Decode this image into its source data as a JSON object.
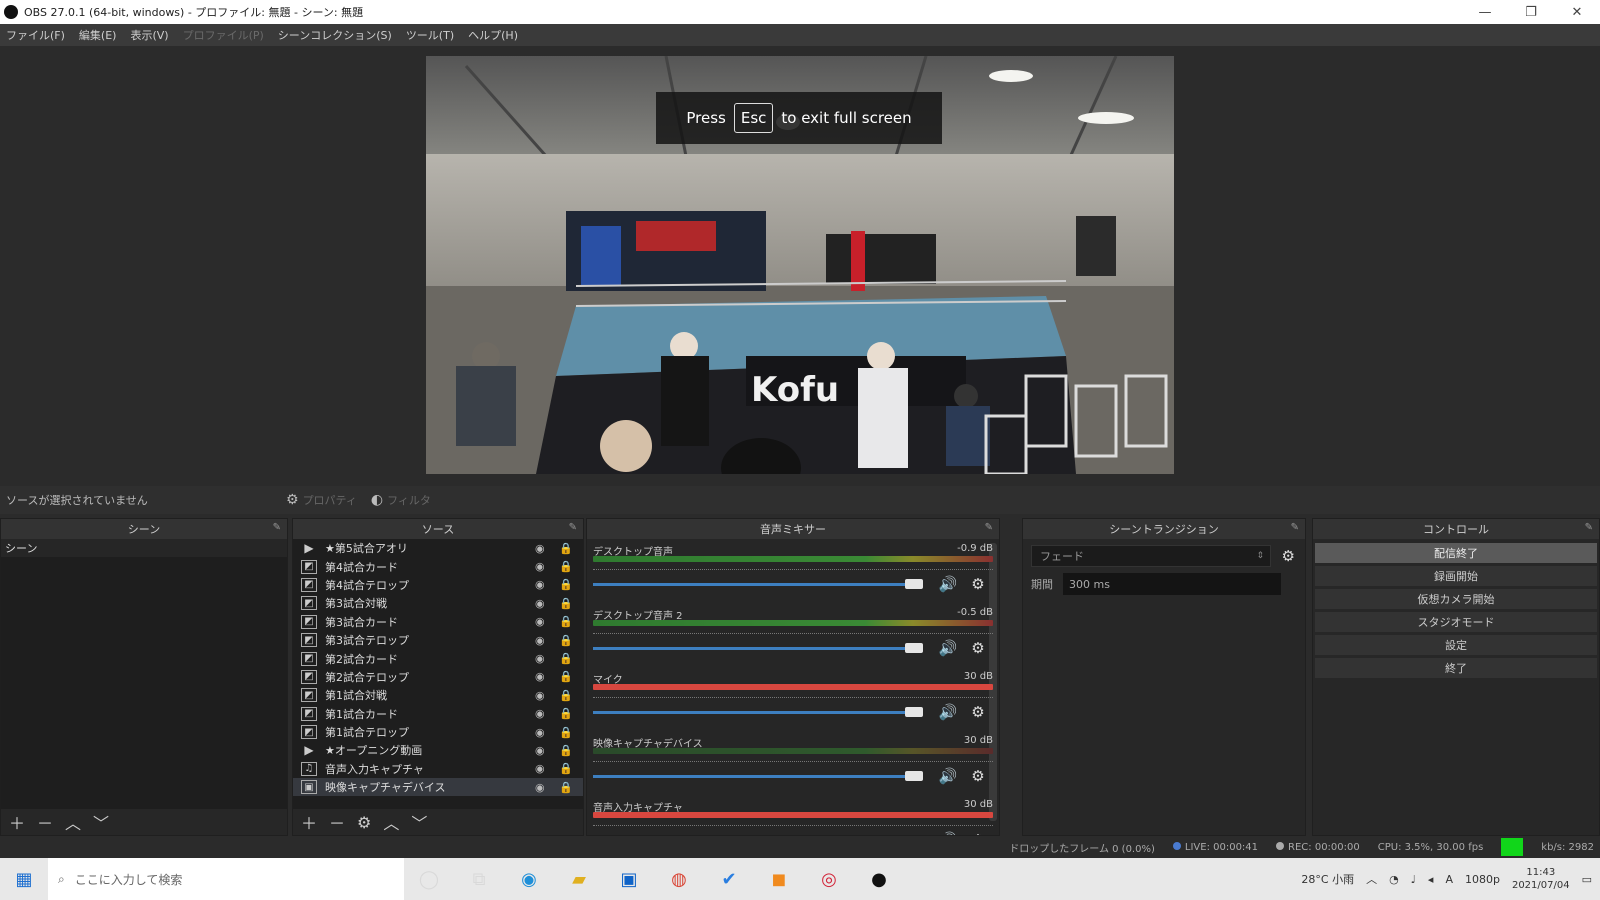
{
  "window": {
    "title": "OBS 27.0.1 (64-bit, windows) - プロファイル: 無題 - シーン: 無題",
    "minimize": "—",
    "restore": "❐",
    "close": "✕"
  },
  "menu": [
    "ファイル(F)",
    "編集(E)",
    "表示(V)",
    "プロファイル(P)",
    "シーンコレクション(S)",
    "ツール(T)",
    "ヘルプ(H)"
  ],
  "fullscreen_notice": {
    "press": "Press",
    "key": "Esc",
    "rest": "to exit full screen"
  },
  "source_bar": {
    "no_source": "ソースが選択されていません",
    "properties": "プロパティ",
    "filters": "フィルタ"
  },
  "scenes": {
    "title": "シーン",
    "items": [
      "シーン"
    ]
  },
  "sources": {
    "title": "ソース",
    "items": [
      {
        "name": "★第5試合アオリ",
        "icon": "play-icon"
      },
      {
        "name": "第4試合カード",
        "icon": "image-icon"
      },
      {
        "name": "第4試合テロップ",
        "icon": "image-icon"
      },
      {
        "name": "第3試合対戦",
        "icon": "image-icon"
      },
      {
        "name": "第3試合カード",
        "icon": "image-icon"
      },
      {
        "name": "第3試合テロップ",
        "icon": "image-icon"
      },
      {
        "name": "第2試合カード",
        "icon": "image-icon"
      },
      {
        "name": "第2試合テロップ",
        "icon": "image-icon"
      },
      {
        "name": "第1試合対戦",
        "icon": "image-icon"
      },
      {
        "name": "第1試合カード",
        "icon": "image-icon"
      },
      {
        "name": "第1試合テロップ",
        "icon": "image-icon"
      },
      {
        "name": "★オープニング動画",
        "icon": "play-icon"
      },
      {
        "name": "音声入力キャプチャ",
        "icon": "mic-icon"
      },
      {
        "name": "映像キャプチャデバイス",
        "icon": "camera-icon"
      }
    ]
  },
  "mixer": {
    "title": "音声ミキサー",
    "channels": [
      {
        "name": "デスクトップ音声",
        "db": "-0.9 dB",
        "meter": "green",
        "volume": 0.95
      },
      {
        "name": "デスクトップ音声 2",
        "db": "-0.5 dB",
        "meter": "green",
        "volume": 0.97
      },
      {
        "name": "マイク",
        "db": "30 dB",
        "meter": "red",
        "volume": 0.99
      },
      {
        "name": "映像キャプチャデバイス",
        "db": "30 dB",
        "meter": "dim",
        "volume": 0.99
      },
      {
        "name": "音声入力キャプチャ",
        "db": "30 dB",
        "meter": "red",
        "volume": 0.99
      }
    ]
  },
  "transitions": {
    "title": "シーントランジション",
    "selected": "フェード",
    "duration_label": "期間",
    "duration": "300 ms"
  },
  "controls": {
    "title": "コントロール",
    "buttons": [
      "配信終了",
      "録画開始",
      "仮想カメラ開始",
      "スタジオモード",
      "設定",
      "終了"
    ]
  },
  "status": {
    "dropped": "ドロップしたフレーム 0 (0.0%)",
    "live": "LIVE: 00:00:41",
    "rec": "REC: 00:00:00",
    "cpu": "CPU: 3.5%, 30.00 fps",
    "bitrate": "kb/s: 2982"
  },
  "taskbar": {
    "search_placeholder": "ここに入力して検索",
    "weather": "28°C 小雨",
    "time": "11:43",
    "date": "2021/07/04",
    "resolution": "1080p"
  },
  "colors": {
    "status_ok": "#11d61a",
    "meter_red": "#d8473f",
    "slider": "#3d7fc0"
  }
}
